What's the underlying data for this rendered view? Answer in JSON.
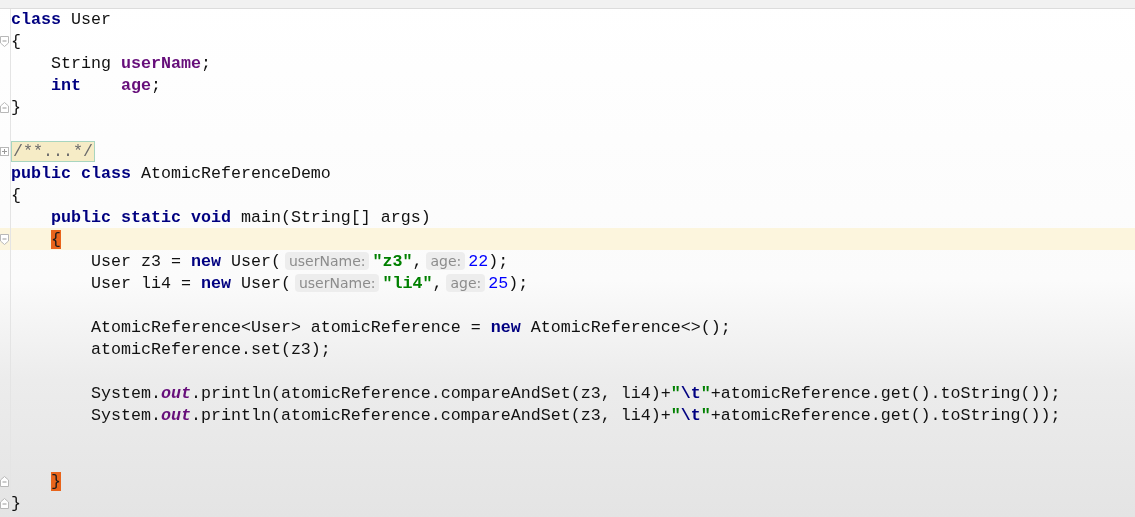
{
  "editor": {
    "lines": [
      {
        "kind": "code",
        "current": false,
        "tokens": [
          {
            "kind": "keyword",
            "text": "class"
          },
          {
            "kind": "plain",
            "text": " User"
          }
        ]
      },
      {
        "kind": "code",
        "current": false,
        "marker": {
          "kind": "fold_start"
        },
        "tokens": [
          {
            "kind": "plain",
            "text": "{"
          }
        ]
      },
      {
        "kind": "code",
        "current": false,
        "tokens": [
          {
            "kind": "plain",
            "text": "    String "
          },
          {
            "kind": "field",
            "text": "userName"
          },
          {
            "kind": "plain",
            "text": ";"
          }
        ]
      },
      {
        "kind": "code",
        "current": false,
        "tokens": [
          {
            "kind": "keyword",
            "text": "    int"
          },
          {
            "kind": "field",
            "text": "    age"
          },
          {
            "kind": "plain",
            "text": ";"
          }
        ]
      },
      {
        "kind": "code",
        "current": false,
        "marker": {
          "kind": "fold_end"
        },
        "tokens": [
          {
            "kind": "plain",
            "text": "}"
          }
        ]
      },
      {
        "kind": "blank",
        "current": false
      },
      {
        "kind": "code",
        "current": false,
        "marker": {
          "kind": "expand"
        },
        "tokens": [
          {
            "kind": "folded",
            "text": "/**...*/"
          }
        ]
      },
      {
        "kind": "code",
        "current": false,
        "tokens": [
          {
            "kind": "keyword",
            "text": "public class"
          },
          {
            "kind": "plain",
            "text": " AtomicReferenceDemo"
          }
        ]
      },
      {
        "kind": "code",
        "current": false,
        "tokens": [
          {
            "kind": "plain",
            "text": "{"
          }
        ]
      },
      {
        "kind": "code",
        "current": false,
        "tokens": [
          {
            "kind": "keyword",
            "text": "    public static void"
          },
          {
            "kind": "plain",
            "text": " main(String[] args)"
          }
        ]
      },
      {
        "kind": "code",
        "current": true,
        "marker": {
          "kind": "fold_start"
        },
        "tokens": [
          {
            "kind": "brace",
            "text": "    {"
          }
        ]
      },
      {
        "kind": "code",
        "current": false,
        "tokens": [
          {
            "kind": "plain",
            "text": "        User z3 = "
          },
          {
            "kind": "keyword",
            "text": "new"
          },
          {
            "kind": "plain",
            "text": " User("
          },
          {
            "kind": "hint",
            "text": "userName:"
          },
          {
            "kind": "string",
            "text": "\"z3\""
          },
          {
            "kind": "plain",
            "text": ","
          },
          {
            "kind": "hint",
            "text": "age:"
          },
          {
            "kind": "number",
            "text": "22"
          },
          {
            "kind": "plain",
            "text": ");"
          }
        ]
      },
      {
        "kind": "code",
        "current": false,
        "tokens": [
          {
            "kind": "plain",
            "text": "        User li4 = "
          },
          {
            "kind": "keyword",
            "text": "new"
          },
          {
            "kind": "plain",
            "text": " User("
          },
          {
            "kind": "hint",
            "text": "userName:"
          },
          {
            "kind": "string",
            "text": "\"li4\""
          },
          {
            "kind": "plain",
            "text": ","
          },
          {
            "kind": "hint",
            "text": "age:"
          },
          {
            "kind": "number",
            "text": "25"
          },
          {
            "kind": "plain",
            "text": ");"
          }
        ]
      },
      {
        "kind": "blank",
        "current": false
      },
      {
        "kind": "code",
        "current": false,
        "tokens": [
          {
            "kind": "plain",
            "text": "        AtomicReference<User> atomicReference = "
          },
          {
            "kind": "keyword",
            "text": "new"
          },
          {
            "kind": "plain",
            "text": " AtomicReference<>();"
          }
        ]
      },
      {
        "kind": "code",
        "current": false,
        "tokens": [
          {
            "kind": "plain",
            "text": "        atomicReference.set(z3);"
          }
        ]
      },
      {
        "kind": "blank",
        "current": false
      },
      {
        "kind": "code",
        "current": false,
        "tokens": [
          {
            "kind": "plain",
            "text": "        System."
          },
          {
            "kind": "static",
            "text": "out"
          },
          {
            "kind": "plain",
            "text": ".println(atomicReference.compareAndSet(z3, li4)+"
          },
          {
            "kind": "string",
            "text": "\""
          },
          {
            "kind": "escape",
            "text": "\\t"
          },
          {
            "kind": "string",
            "text": "\""
          },
          {
            "kind": "plain",
            "text": "+atomicReference.get().toString());"
          }
        ]
      },
      {
        "kind": "code",
        "current": false,
        "tokens": [
          {
            "kind": "plain",
            "text": "        System."
          },
          {
            "kind": "static",
            "text": "out"
          },
          {
            "kind": "plain",
            "text": ".println(atomicReference.compareAndSet(z3, li4)+"
          },
          {
            "kind": "string",
            "text": "\""
          },
          {
            "kind": "escape",
            "text": "\\t"
          },
          {
            "kind": "string",
            "text": "\""
          },
          {
            "kind": "plain",
            "text": "+atomicReference.get().toString());"
          }
        ]
      },
      {
        "kind": "blank",
        "current": false
      },
      {
        "kind": "blank",
        "current": false
      },
      {
        "kind": "code",
        "current": false,
        "marker": {
          "kind": "fold_end"
        },
        "tokens": [
          {
            "kind": "brace",
            "text": "    }"
          }
        ]
      },
      {
        "kind": "code",
        "current": false,
        "marker": {
          "kind": "fold_end"
        },
        "tokens": [
          {
            "kind": "plain",
            "text": "}"
          }
        ]
      }
    ]
  }
}
